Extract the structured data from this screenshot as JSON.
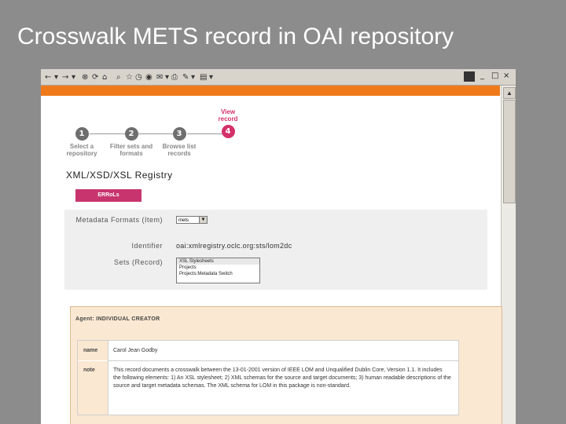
{
  "slide_title": "Crosswalk METS record in OAI repository",
  "toolbar": {
    "icons": [
      "back-icon",
      "forward-icon",
      "stop-icon",
      "refresh-icon",
      "home-icon",
      "search-icon",
      "favorites-icon",
      "history-icon",
      "media-icon",
      "mail-icon",
      "print-icon",
      "edit-icon",
      "discuss-icon"
    ],
    "window_controls": [
      "_",
      "□",
      "×"
    ]
  },
  "steps": [
    {
      "number": "1",
      "label": "Select a repository",
      "active": false
    },
    {
      "number": "2",
      "label": "Filter sets and formats",
      "active": false
    },
    {
      "number": "3",
      "label": "Browse list records",
      "active": false
    },
    {
      "number": "4",
      "label": "View record",
      "active": true
    }
  ],
  "registry_title": "XML/XSD/XSL Registry",
  "err_button": "ERRoLs",
  "form": {
    "metadata_label": "Metadata Formats (Item)",
    "metadata_value": "mets",
    "identifier_label": "Identifier",
    "identifier_value": "oai:xmlregistry.oclc.org:sts/lom2dc",
    "sets_label": "Sets (Record)",
    "sets_options": [
      "XSL Stylesheets",
      "Projects",
      "Projects:Metadata Switch"
    ]
  },
  "agent": {
    "header": "Agent: INDIVIDUAL CREATOR",
    "name_label": "name",
    "name_value": "Carol Jean Godby",
    "note_label": "note",
    "note_value": "This record documents a crosswalk between the 13-01-2001 version of IEEE LOM and Unqualified Dublin Core, Version 1.1. It includes the following elements: 1) An XSL stylesheet; 2) XML schemas for the source and target documents; 3) human readable descriptions of the source and target metadata schemas. The XML schema for LOM in this package is non-standard."
  },
  "colors": {
    "background": "#8c8c8c",
    "orange_bar": "#f07a1a",
    "accent": "#d4306a",
    "agent_bg": "#fbe8d2"
  }
}
